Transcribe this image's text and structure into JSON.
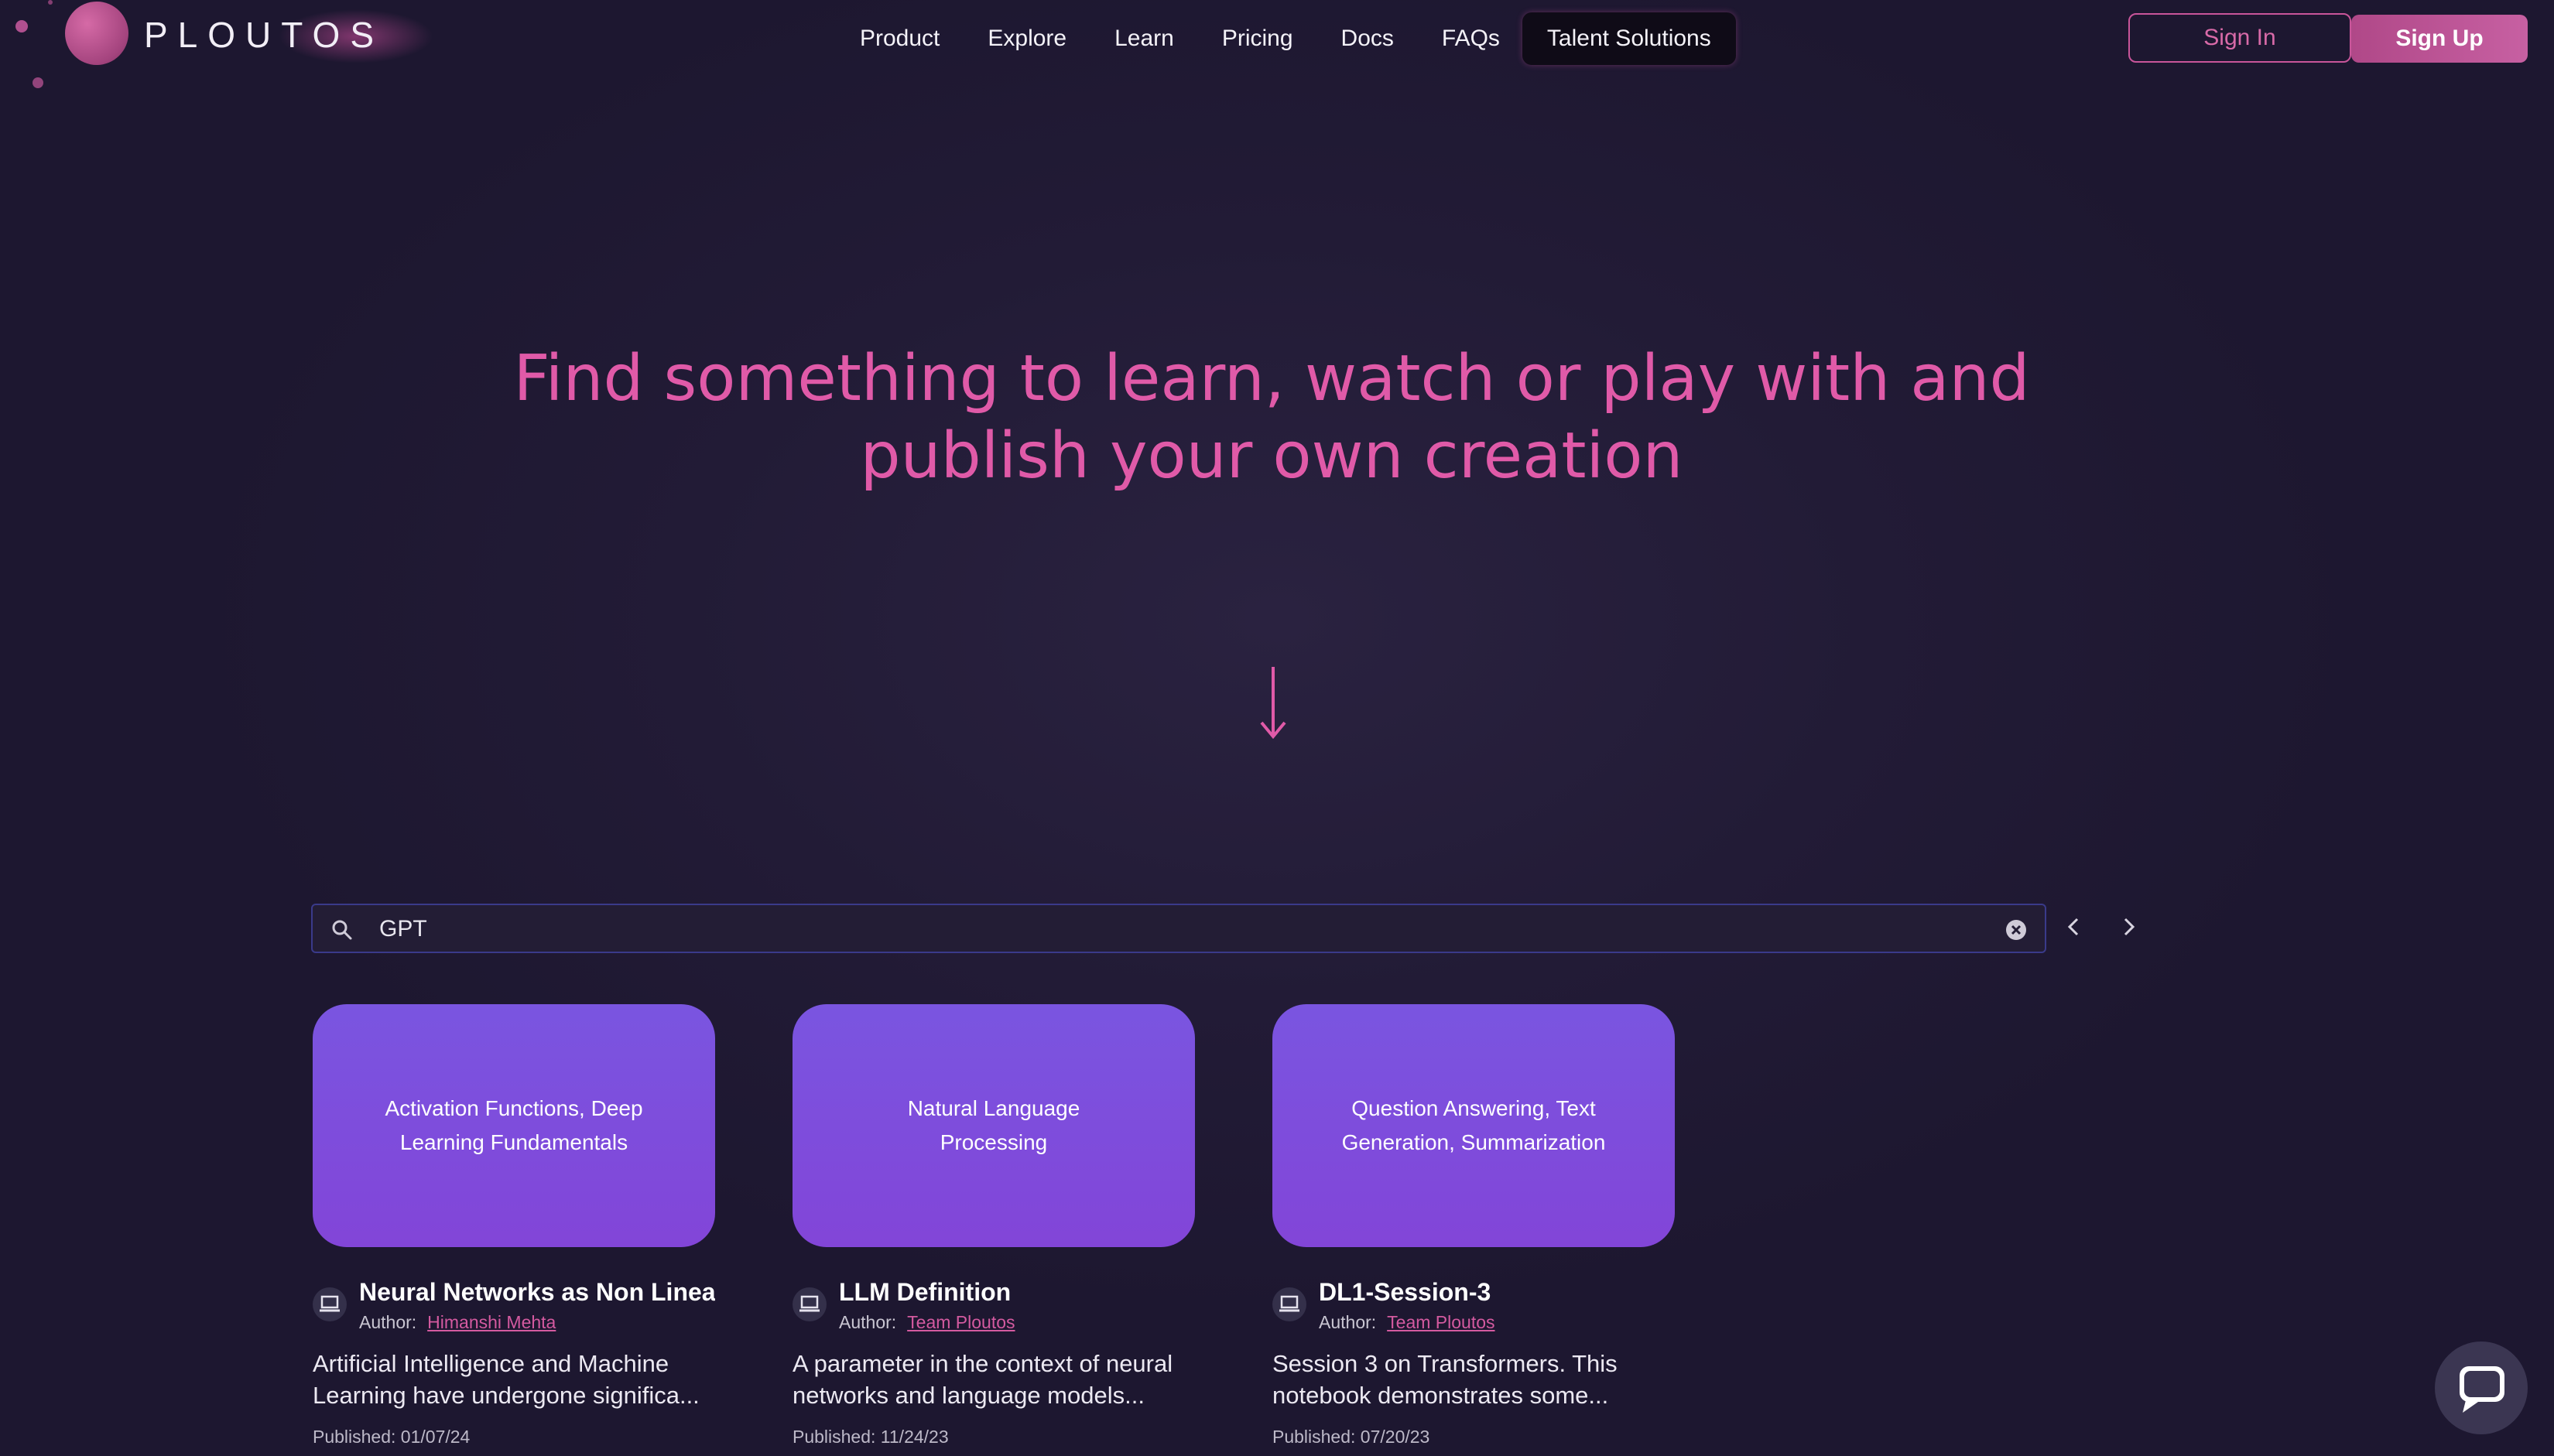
{
  "header": {
    "logo_text": "PLOUTOS",
    "nav": [
      "Product",
      "Explore",
      "Learn",
      "Pricing",
      "Docs",
      "FAQs",
      "Talent Solutions"
    ],
    "sign_in": "Sign In",
    "sign_up": "Sign Up"
  },
  "hero": {
    "line1": "Find something to learn, watch or play with and",
    "line2": "publish your own creation"
  },
  "search": {
    "value": "GPT",
    "icon": "search-icon"
  },
  "cards": [
    {
      "thumb_label": "Activation Functions, Deep Learning Fundamentals",
      "title": "Neural Networks as Non Linear E",
      "author_label": "Author:",
      "author": "Himanshi Mehta",
      "description": "Artificial Intelligence and Machine Learning have undergone significa...",
      "published": "Published: 01/07/24"
    },
    {
      "thumb_label": "Natural Language Processing",
      "title": "LLM Definition",
      "author_label": "Author:",
      "author": "Team Ploutos",
      "description": "A parameter in the context of neural networks and language models...",
      "published": "Published: 11/24/23"
    },
    {
      "thumb_label": "Question Answering, Text Generation, Summarization",
      "title": "DL1-Session-3",
      "author_label": "Author:",
      "author": "Team Ploutos",
      "description": "Session 3 on Transformers. This notebook demonstrates some...",
      "published": "Published: 07/20/23"
    }
  ],
  "colors": {
    "accent": "#e05aa8",
    "card": "#7a55e0",
    "background": "#221b36"
  }
}
